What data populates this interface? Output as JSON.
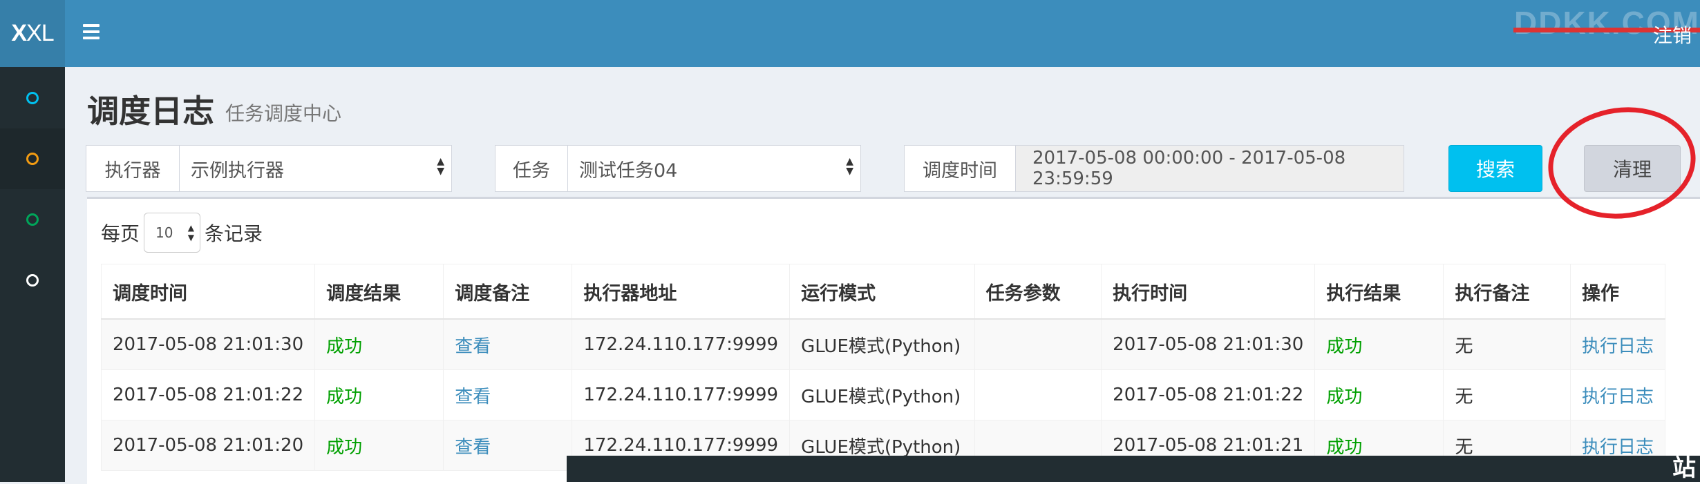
{
  "logo": {
    "bold": "X",
    "rest": "XL"
  },
  "header": {
    "watermark": "DDKK.COM",
    "logout": "注销"
  },
  "sidebar": {
    "items": [
      {
        "icon": "circle-icon",
        "color": "#00c0ef"
      },
      {
        "icon": "circle-icon",
        "color": "#f39c12"
      },
      {
        "icon": "circle-icon",
        "color": "#00a65a"
      },
      {
        "icon": "circle-icon",
        "color": "#ffffff"
      }
    ]
  },
  "page": {
    "title": "调度日志",
    "subtitle": "任务调度中心"
  },
  "filters": {
    "executor_label": "执行器",
    "executor_value": "示例执行器",
    "task_label": "任务",
    "task_value": "测试任务04",
    "time_label": "调度时间",
    "time_value": "2017-05-08 00:00:00 - 2017-05-08 23:59:59",
    "search_label": "搜索",
    "clean_label": "清理"
  },
  "table": {
    "perpage_prefix": "每页",
    "perpage_value": "10",
    "perpage_suffix": "条记录",
    "headers": [
      "调度时间",
      "调度结果",
      "调度备注",
      "执行器地址",
      "运行模式",
      "任务参数",
      "执行时间",
      "执行结果",
      "执行备注",
      "操作"
    ],
    "rows": [
      {
        "trigger_time": "2017-05-08 21:01:30",
        "trigger_result": "成功",
        "trigger_note": "查看",
        "address": "172.24.110.177:9999",
        "mode": "GLUE模式(Python)",
        "param": "",
        "handle_time": "2017-05-08 21:01:30",
        "handle_result": "成功",
        "handle_note": "无",
        "op": "执行日志"
      },
      {
        "trigger_time": "2017-05-08 21:01:22",
        "trigger_result": "成功",
        "trigger_note": "查看",
        "address": "172.24.110.177:9999",
        "mode": "GLUE模式(Python)",
        "param": "",
        "handle_time": "2017-05-08 21:01:22",
        "handle_result": "成功",
        "handle_note": "无",
        "op": "执行日志"
      },
      {
        "trigger_time": "2017-05-08 21:01:20",
        "trigger_result": "成功",
        "trigger_note": "查看",
        "address": "172.24.110.177:9999",
        "mode": "GLUE模式(Python)",
        "param": "",
        "handle_time": "2017-05-08 21:01:21",
        "handle_result": "成功",
        "handle_note": "无",
        "op": "执行日志"
      }
    ]
  },
  "overlay": {
    "tail": "站"
  }
}
